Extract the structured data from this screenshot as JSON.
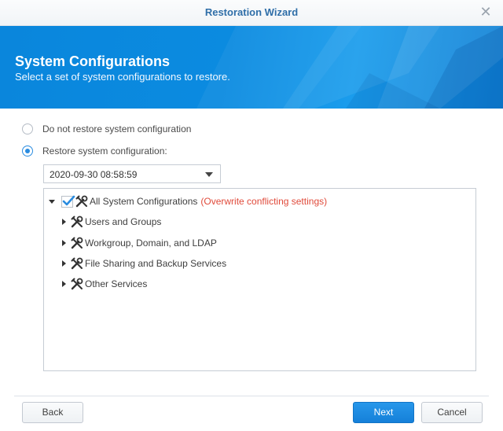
{
  "window": {
    "title": "Restoration Wizard",
    "close_glyph": "✕"
  },
  "header": {
    "heading": "System Configurations",
    "subtitle": "Select a set of system configurations to restore."
  },
  "options": {
    "no_restore": {
      "label": "Do not restore system configuration",
      "selected": false
    },
    "restore": {
      "label": "Restore system configuration:",
      "selected": true
    }
  },
  "snapshot_select": {
    "value": "2020-09-30 08:58:59"
  },
  "tree": {
    "root": {
      "label": "All System Configurations",
      "note": "(Overwrite conflicting settings)",
      "checked": true,
      "expanded": true,
      "icon": "tools-icon"
    },
    "children": [
      {
        "label": "Users and Groups",
        "icon": "tools-icon"
      },
      {
        "label": "Workgroup, Domain, and LDAP",
        "icon": "tools-icon"
      },
      {
        "label": "File Sharing and Backup Services",
        "icon": "tools-icon"
      },
      {
        "label": "Other Services",
        "icon": "tools-icon"
      }
    ]
  },
  "buttons": {
    "back": "Back",
    "next": "Next",
    "cancel": "Cancel"
  },
  "colors": {
    "accent": "#2a8ce0",
    "banner": "#0b8be0",
    "title_text": "#2f6ea8",
    "warning_text": "#e04a3a"
  }
}
